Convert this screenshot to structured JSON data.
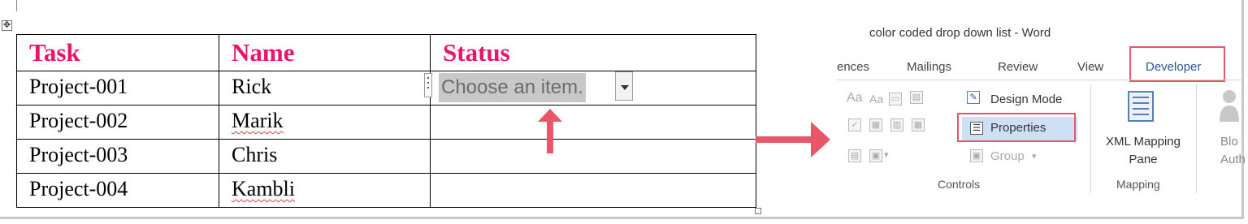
{
  "document": {
    "headers": [
      "Task",
      "Name",
      "Status"
    ],
    "rows": [
      {
        "task": "Project-001",
        "name": "Rick",
        "status_placeholder": "Choose an item."
      },
      {
        "task": "Project-002",
        "name": "Marik"
      },
      {
        "task": "Project-003",
        "name": "Chris"
      },
      {
        "task": "Project-004",
        "name": "Kambli"
      }
    ],
    "header_color": "#e8156c"
  },
  "ribbon": {
    "window_title": "color coded drop down list - Word",
    "tabs": [
      "ences",
      "Mailings",
      "Review",
      "View",
      "Developer"
    ],
    "active_tab": "Developer",
    "controls": {
      "design_mode": "Design Mode",
      "properties": "Properties",
      "group": "Group",
      "label": "Controls"
    },
    "mapping": {
      "xml_mapping_line1": "XML Mapping",
      "xml_mapping_line2": "Pane",
      "label": "Mapping"
    },
    "truncated_next": {
      "line1": "Blo",
      "line2": "Auth"
    }
  },
  "annotations": {
    "highlight_color": "#e8566a"
  }
}
